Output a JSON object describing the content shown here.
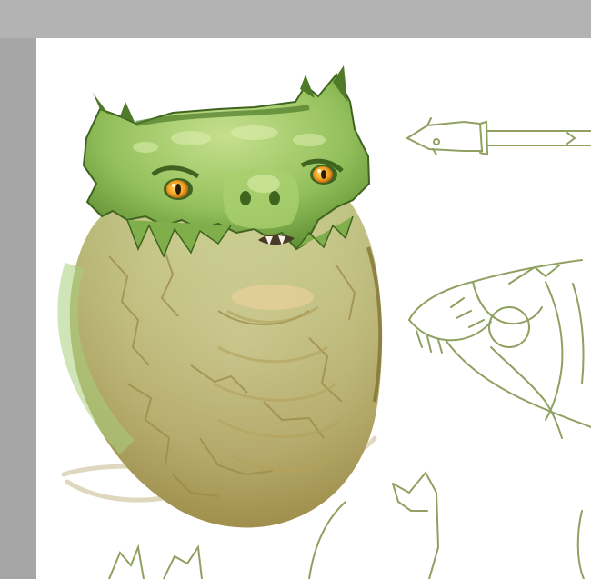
{
  "artwork": {
    "subject": "dragon-head-painting",
    "sketches": [
      "spear-sketch",
      "dragon-profile-sketch",
      "claw-sketches"
    ]
  },
  "colors": {
    "workspace_background": "#b3b3b3",
    "canvas_background": "#ffffff",
    "scales_green": "#8fbc5a",
    "dark_green": "#4f7a2a",
    "neck_tan": "#cfc489",
    "shadow_olive": "#8a7a3c",
    "eye_orange": "#f2a020",
    "sketch_line": "#8fa060"
  }
}
